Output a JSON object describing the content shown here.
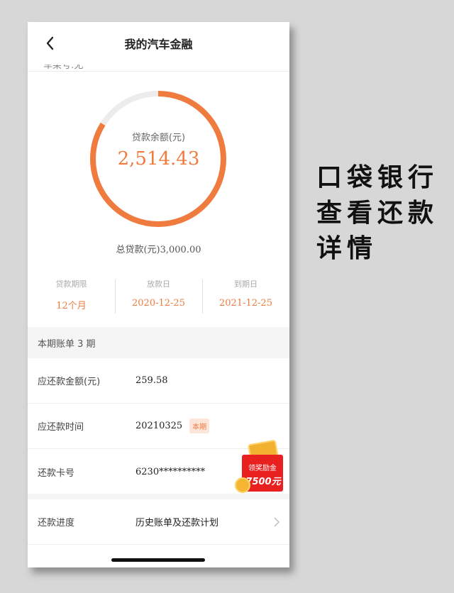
{
  "nav": {
    "title": "我的汽车金融"
  },
  "peek_text": "车架号:无",
  "loan": {
    "balance_label": "贷款余额(元)",
    "balance_value": "2,514.43",
    "total_text": "总贷款(元)3,000.00",
    "accent_color": "#f07b3f"
  },
  "stats": [
    {
      "label": "贷款期限",
      "value": "12个月"
    },
    {
      "label": "放款日",
      "value": "2020-12-25"
    },
    {
      "label": "到期日",
      "value": "2021-12-25"
    }
  ],
  "bill": {
    "section_title": "本期账单 3 期",
    "amount_label": "应还款金额(元)",
    "amount_value": "259.58",
    "date_label": "应还款时间",
    "date_value": "20210325",
    "date_badge": "本期",
    "card_label": "还款卡号",
    "card_value": "6230**********"
  },
  "progress": {
    "label": "还款进度",
    "value": "历史账单及还款计划"
  },
  "promo": {
    "title": "领奖励金",
    "amount": "7500元"
  },
  "caption": {
    "line1": "口袋银行",
    "line2": "查看还款",
    "line3": "详情"
  },
  "icons": {
    "back": "chevron-left-icon",
    "row_arrow": "chevron-right-icon"
  }
}
